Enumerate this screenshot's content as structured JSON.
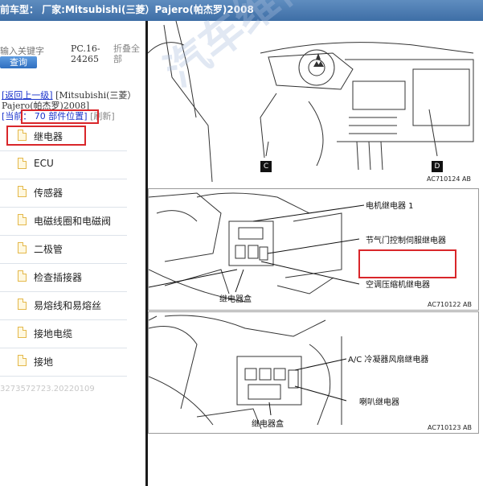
{
  "title_bar": {
    "text": "前车型： 厂家:Mitsubishi(三菱）Pajero(帕杰罗)2008"
  },
  "sidebar": {
    "search_placeholder": "输入关键字",
    "search_button": "查询",
    "pc_code": "PC.16-24265",
    "fold_all": "折叠全部",
    "back_link": "[返回上一级]",
    "path": "[Mitsubishi(三菱）Pajero(帕杰罗)2008]",
    "current_label": "[当前：",
    "current_count": "70",
    "current_location": "部件位置]",
    "refresh": "[刷新]",
    "items": [
      {
        "label": "继电器"
      },
      {
        "label": "ECU"
      },
      {
        "label": "传感器"
      },
      {
        "label": "电磁线圈和电磁阀"
      },
      {
        "label": "二极管"
      },
      {
        "label": "检查插接器"
      },
      {
        "label": "易熔线和易熔丝"
      },
      {
        "label": "接地电缆"
      },
      {
        "label": "接地"
      }
    ],
    "footer_id": "3273572723.20220109"
  },
  "diagram": {
    "panel1": {
      "label_c": "C",
      "label_d": "D",
      "code": "AC710124 AB"
    },
    "panel2": {
      "callout_1": "电机继电器 1",
      "callout_2": "节气门控制伺服继电器",
      "callout_3": "空调压缩机继电器",
      "callout_4": "继电器盒",
      "code": "AC710122 AB"
    },
    "panel3": {
      "callout_1": "A/C 冷凝器风扇继电器",
      "callout_2": "喇叭继电器",
      "callout_3": "继电器盒",
      "code": "AC710123 AB"
    },
    "watermark": "汽车维修资料"
  },
  "colors": {
    "title_bar": "#4a7bb5",
    "highlight": "#d9262a",
    "link": "#1a33cc"
  }
}
